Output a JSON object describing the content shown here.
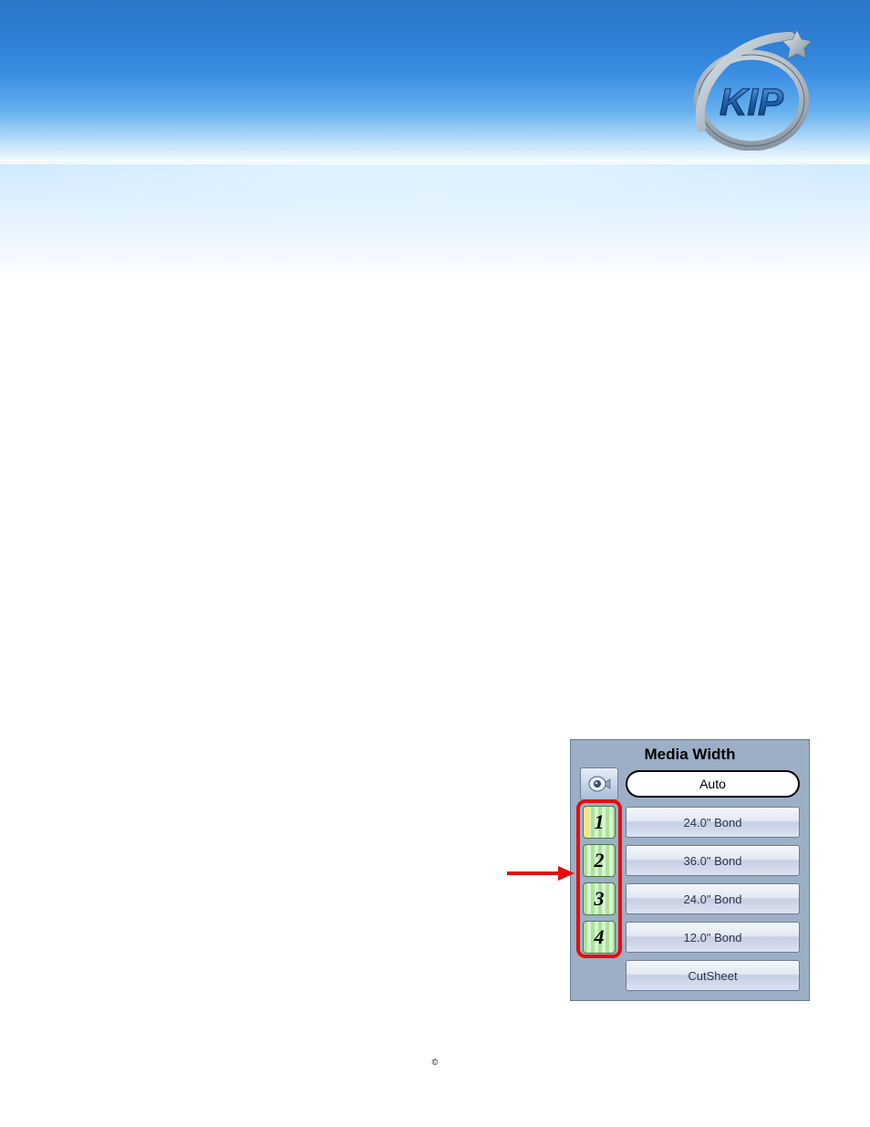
{
  "brand": {
    "name": "KIP"
  },
  "media_panel": {
    "title": "Media Width",
    "auto_label": "Auto",
    "rolls": [
      {
        "num": "1",
        "label": "24.0\" Bond"
      },
      {
        "num": "2",
        "label": "36.0\" Bond"
      },
      {
        "num": "3",
        "label": "24.0\" Bond"
      },
      {
        "num": "4",
        "label": "12.0\" Bond"
      }
    ],
    "cutsheet_label": "CutSheet"
  },
  "footer": {
    "copyright": "©"
  }
}
